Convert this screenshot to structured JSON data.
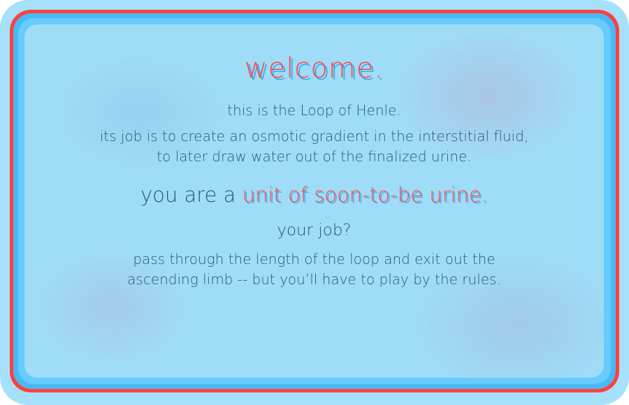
{
  "colors": {
    "accent_red": "#ff4a4a",
    "frame_blue": "#48b9f2",
    "text": "#2a5878",
    "panel": "#9fdcf8"
  },
  "intro": {
    "title": "welcome.",
    "line1": "this is the Loop of Henle.",
    "line2a": "its job is to create an osmotic gradient in the interstitial fluid,",
    "line2b": "to later draw water out of the finalized urine.",
    "line3_prefix": "you are a ",
    "line3_highlight": "unit of soon-to-be urine.",
    "line4": "your job?",
    "line5a": "pass through the length of the loop and exit out the",
    "line5b": "ascending limb -- but you’ll have to play by the rules."
  }
}
